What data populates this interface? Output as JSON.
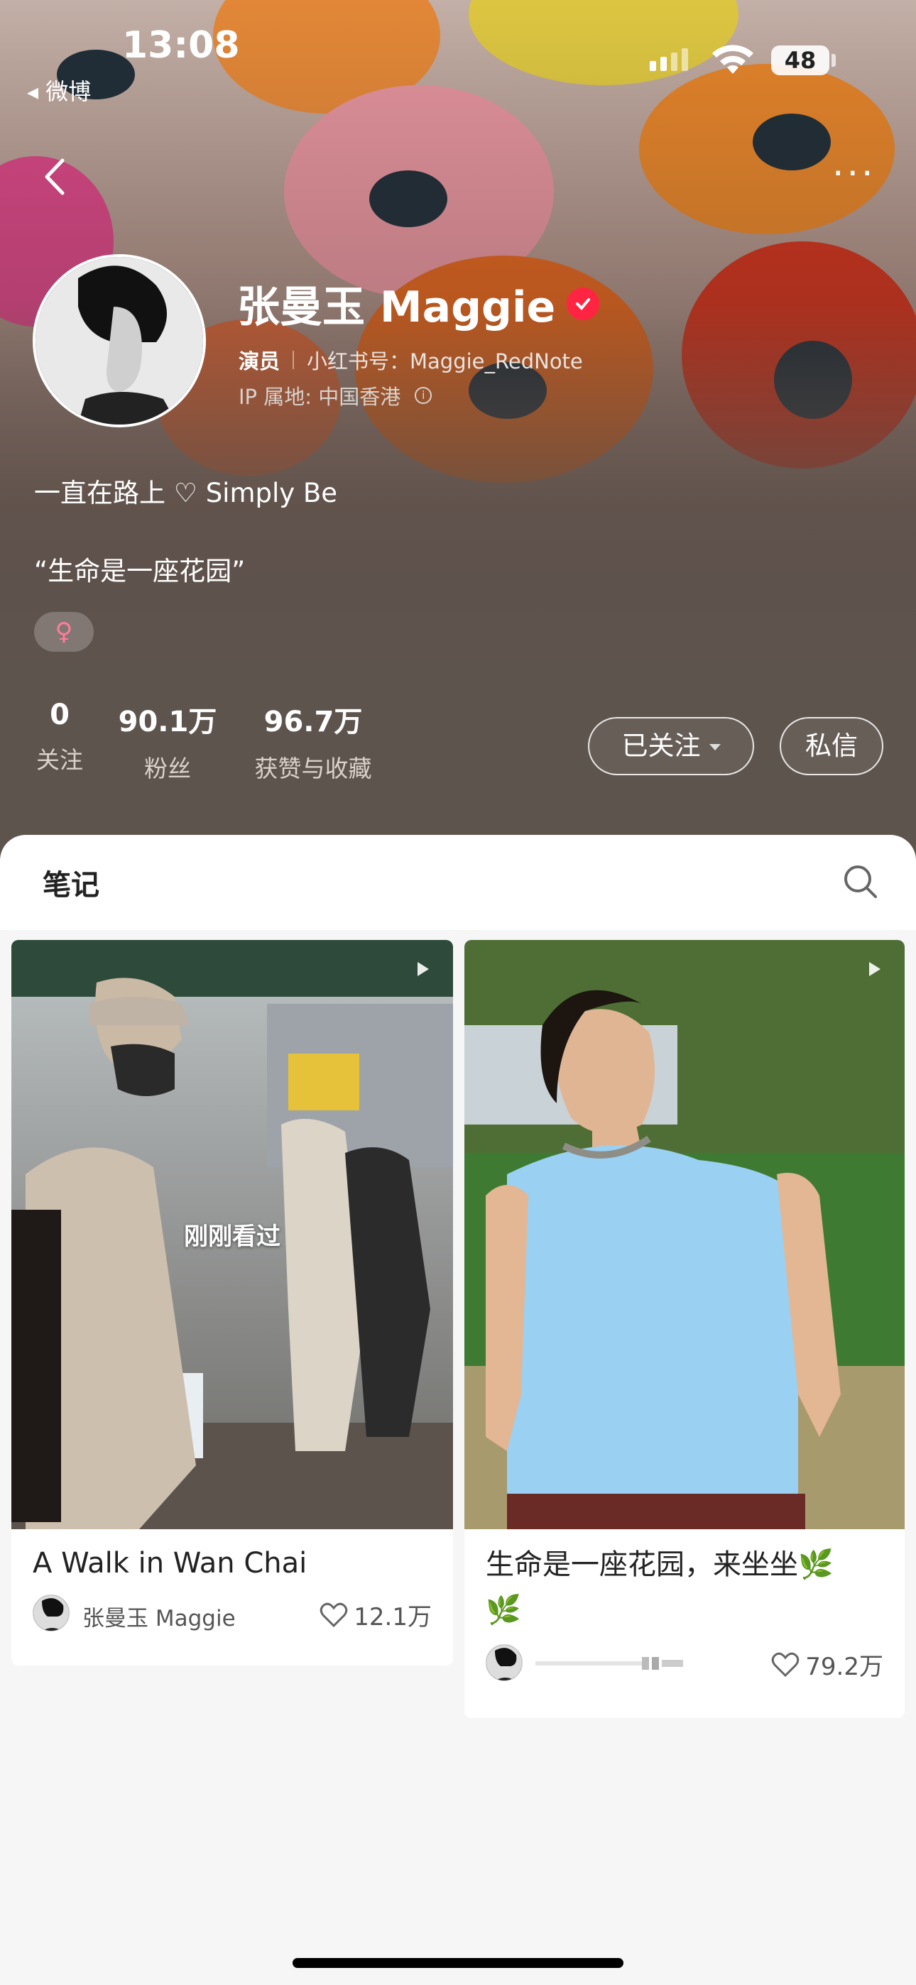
{
  "status_bar": {
    "time": "13:08",
    "back_app": "◂ 微博",
    "battery": "48"
  },
  "profile": {
    "name": "张曼玉 Maggie",
    "role": "演员",
    "redbook_id": "小红书号：Maggie_RedNote",
    "ip_location": "IP 属地: 中国香港",
    "bio": "一直在路上 ♡ Simply Be",
    "quote": "“生命是一座花园”",
    "gender_symbol": "♀"
  },
  "stats": [
    {
      "value": "0",
      "label": "关注"
    },
    {
      "value": "90.1万",
      "label": "粉丝"
    },
    {
      "value": "96.7万",
      "label": "获赞与收藏"
    }
  ],
  "actions": {
    "follow_label": "已关注",
    "message_label": "私信"
  },
  "tabs": {
    "notes_label": "笔记"
  },
  "notes": [
    {
      "title": "A Walk in Wan Chai",
      "author": "张曼玉 Maggie",
      "likes": "12.1万",
      "overlay": "刚刚看过"
    },
    {
      "title": "生命是一座花园，来坐坐🌿🌿",
      "author": "",
      "likes": "79.2万"
    }
  ],
  "colors": {
    "accent": "#ff2442",
    "header_bg": "#5e544e"
  }
}
